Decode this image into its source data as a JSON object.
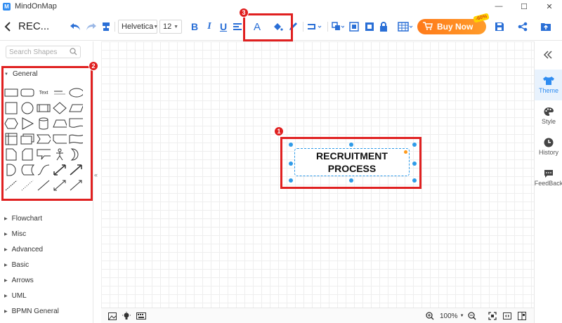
{
  "app": {
    "title": "MindOnMap",
    "logo_letter": "M"
  },
  "window": {
    "minimize": "—",
    "maximize": "☐",
    "close": "✕"
  },
  "toolbar": {
    "doc_title": "REC...",
    "font_family": "Helvetica",
    "font_size": "12",
    "bold": "B",
    "italic": "I",
    "underline": "U",
    "text_color_label": "A",
    "buy_label": "Buy Now",
    "buy_badge": "-60%"
  },
  "sidebar": {
    "search_placeholder": "Search Shapes",
    "expanded_category": "General",
    "text_shape_label": "Text",
    "categories": [
      "Flowchart",
      "Misc",
      "Advanced",
      "Basic",
      "Arrows",
      "UML",
      "BPMN General"
    ]
  },
  "canvas": {
    "node_text_line1": "RECRUITMENT",
    "node_text_line2": "PROCESS"
  },
  "bottombar": {
    "zoom": "100%"
  },
  "rightpanel": {
    "items": [
      {
        "label": "Theme",
        "icon": "shirt-icon",
        "active": true
      },
      {
        "label": "Style",
        "icon": "palette-icon"
      },
      {
        "label": "History",
        "icon": "clock-icon"
      },
      {
        "label": "FeedBack",
        "icon": "chat-icon"
      }
    ]
  },
  "annotations": {
    "box1": "1",
    "box2": "2",
    "box3": "3"
  },
  "colors": {
    "accent": "#2f8cf1",
    "annotation_red": "#e02020",
    "buy_orange": "#ff8a1f"
  }
}
